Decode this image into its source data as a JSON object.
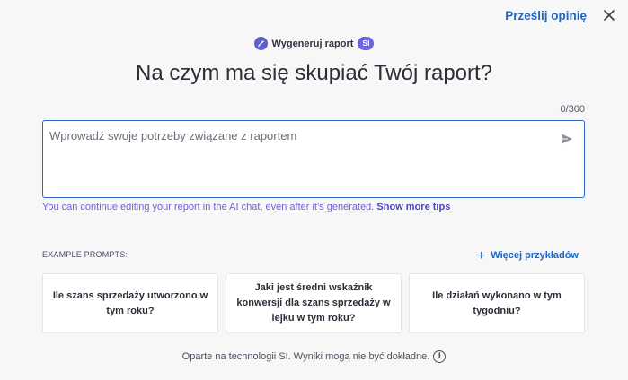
{
  "header": {
    "feedback_label": "Prześlij opinię"
  },
  "pill": {
    "label": "Wygeneruj raport",
    "badge": "SI"
  },
  "title": "Na czym ma się skupiać Twój raport?",
  "input": {
    "counter": "0/300",
    "placeholder": "Wprowadź swoje potrzeby związane z raportem",
    "value": ""
  },
  "hint": {
    "text": "You can continue editing your report in the AI chat, even after it’s generated.",
    "link": "Show more tips"
  },
  "examples": {
    "label": "EXAMPLE PROMPTS:",
    "more_label": "Więcej przykładów",
    "cards": [
      {
        "text": "Ile szans sprzedaży utworzono w tym roku?"
      },
      {
        "text": "Jaki jest średni wskaźnik konwersji dla szans sprzedaży w lejku w tym roku?"
      },
      {
        "text": "Ile działań wykonano w tym tygodniu?"
      }
    ]
  },
  "footer": {
    "text": "Oparte na technologii SI. Wyniki mogą nie być dokładne.",
    "info_icon": "i"
  },
  "icons": [
    "magic-wand-icon",
    "close-icon",
    "send-icon",
    "plus-icon",
    "info-icon"
  ],
  "colors": {
    "accent": "#1e66c8",
    "ai_purple": "#6b63e6",
    "hint_purple": "#6b63d9",
    "background": "#f7f7f8"
  }
}
